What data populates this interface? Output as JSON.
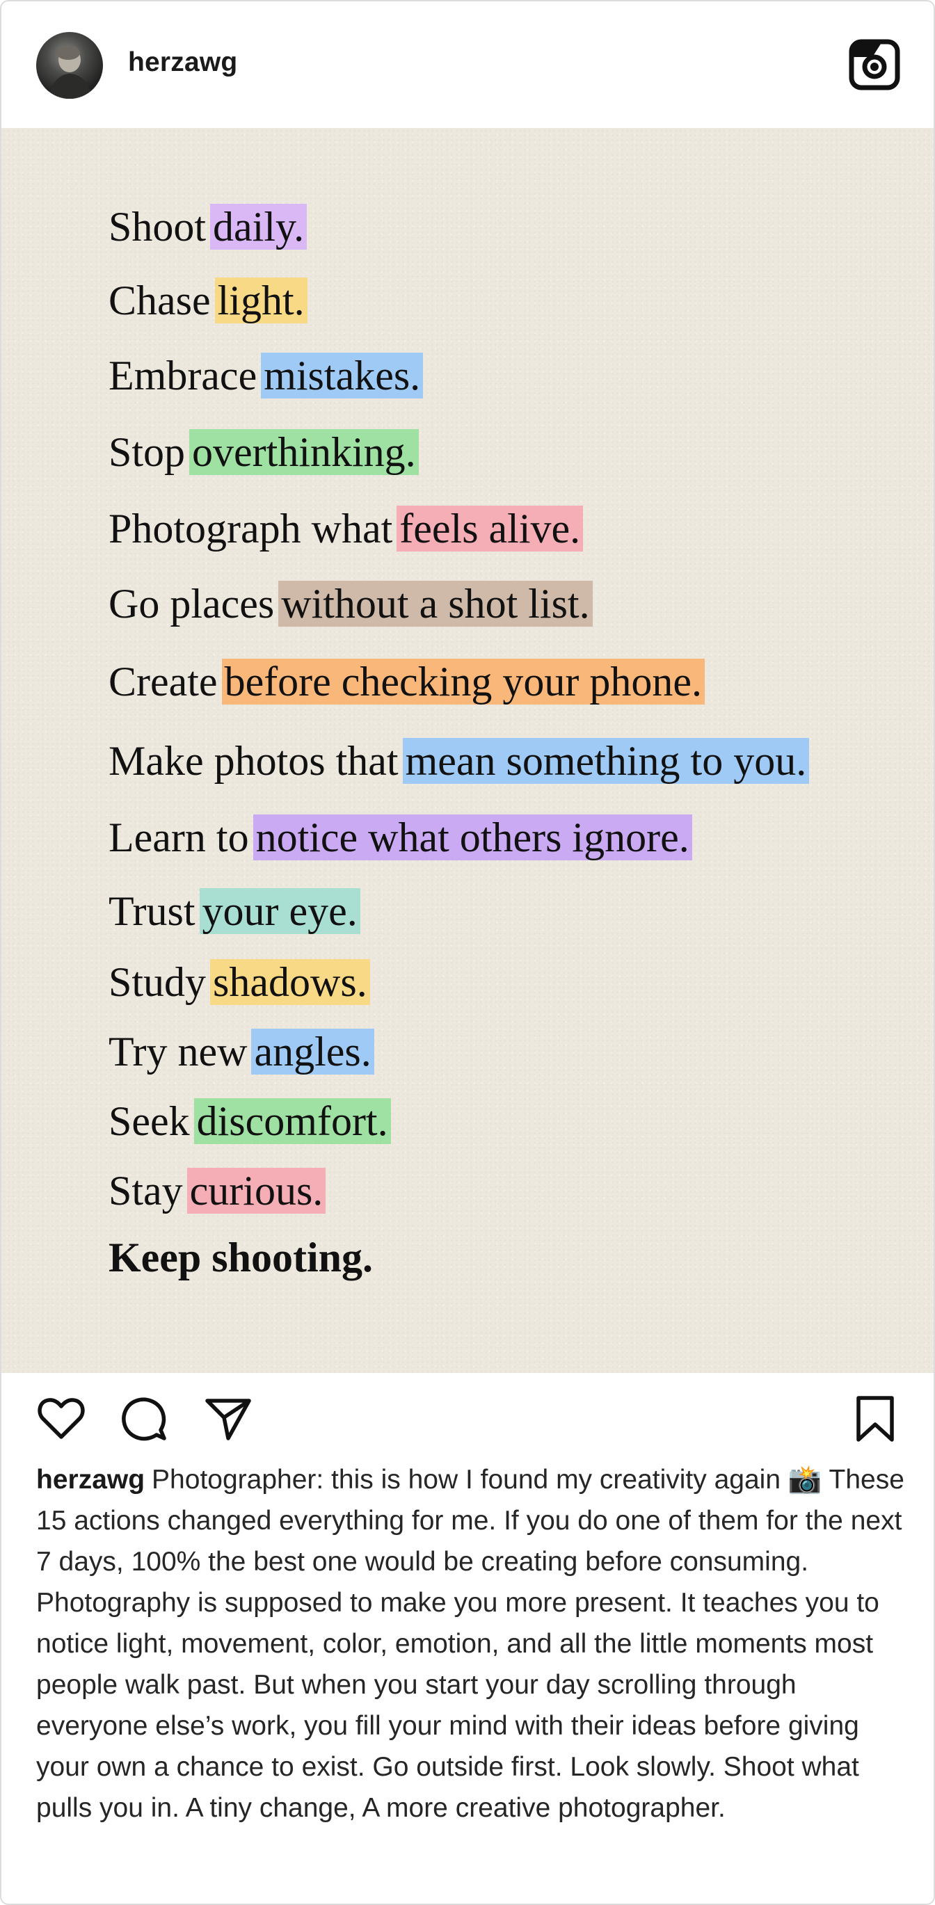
{
  "header": {
    "username": "herzawg"
  },
  "icons": {
    "avatar": "avatar-photo",
    "instagram": "instagram-icon",
    "like": "heart-icon",
    "comment": "comment-icon",
    "share": "paper-plane-icon",
    "save": "bookmark-icon"
  },
  "post": {
    "lines": [
      {
        "plain": "Shoot",
        "highlight": "daily.",
        "color": "#d9b8f5"
      },
      {
        "plain": "Chase",
        "highlight": "light.",
        "color": "#f8d985"
      },
      {
        "plain": "Embrace",
        "highlight": "mistakes.",
        "color": "#9fcaf5"
      },
      {
        "plain": "Stop",
        "highlight": "overthinking.",
        "color": "#9fe0a3"
      },
      {
        "plain": "Photograph what",
        "highlight": "feels alive.",
        "color": "#f6aeb6"
      },
      {
        "plain": "Go places",
        "highlight": "without a shot list.",
        "color": "#cfb9a8"
      },
      {
        "plain": "Create",
        "highlight": "before checking your phone.",
        "color": "#f9b77a"
      },
      {
        "plain": "Make photos that",
        "highlight": "mean something to you.",
        "color": "#9fcaf5"
      },
      {
        "plain": "Learn to",
        "highlight": "notice what others ignore.",
        "color": "#c9aaf3"
      },
      {
        "plain": "Trust",
        "highlight": "your eye.",
        "color": "#a9dfd3"
      },
      {
        "plain": "Study",
        "highlight": "shadows.",
        "color": "#f8d985"
      },
      {
        "plain": "Try new",
        "highlight": "angles.",
        "color": "#9fcaf5"
      },
      {
        "plain": "Seek",
        "highlight": "discomfort.",
        "color": "#9fe0a3"
      },
      {
        "plain": "Stay",
        "highlight": "curious.",
        "color": "#f6aeb6"
      }
    ],
    "final_line": "Keep shooting."
  },
  "caption": {
    "username": "herzawg",
    "text": "Photographer: this is how I found my creativity again 📸 These 15 actions changed everything for me. If you do one of them for the next 7 days, 100% the best one would be creating before consuming. Photography is supposed to make you more present. It teaches you to notice light, movement, color, emotion, and all the little moments most people walk past. But when you start your day scrolling through everyone else’s work, you fill your mind with their ideas before giving your own a chance to exist. Go outside first. Look slowly. Shoot what pulls you in. A tiny change, A more creative photographer."
  }
}
